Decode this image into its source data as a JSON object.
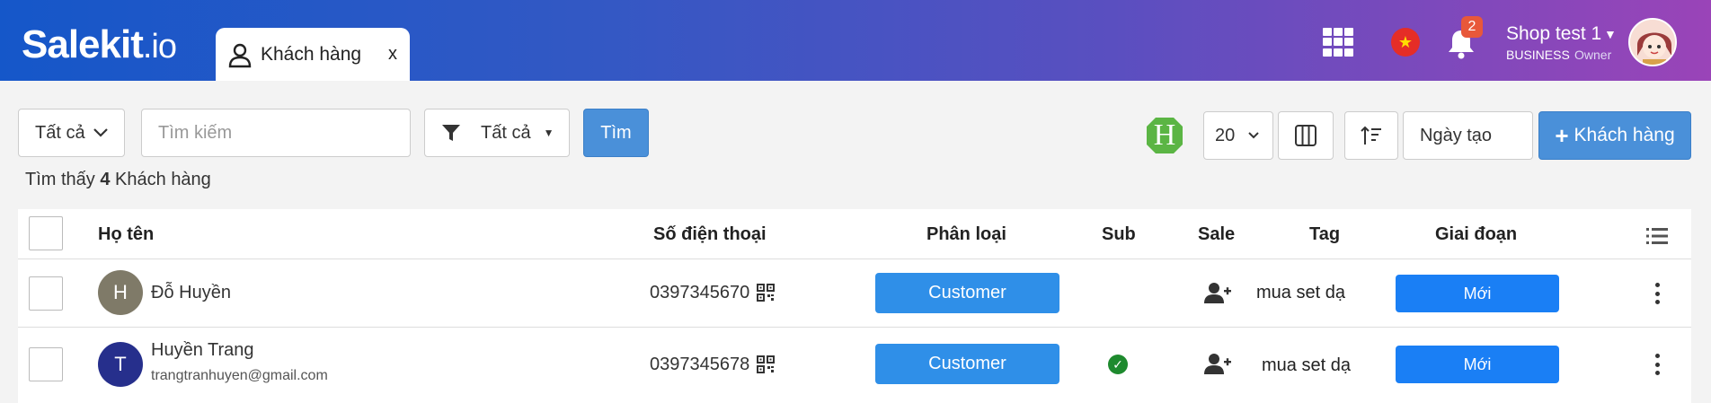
{
  "header": {
    "logo": "Salekit",
    "logo_suffix": ".io",
    "tab": {
      "label": "Khách hàng",
      "close": "x"
    },
    "notifications_count": "2",
    "shop": {
      "name": "Shop test 1",
      "plan": "BUSINESS",
      "role": "Owner"
    },
    "icons": [
      "apps-grid-icon",
      "vietnam-flag-icon",
      "bell-icon",
      "user-avatar"
    ]
  },
  "toolbar": {
    "status_filter": "Tất cả",
    "search_placeholder": "Tìm kiếm",
    "filter_value": "Tất cả",
    "search_button": "Tìm",
    "page_size": "20",
    "sort_field": "Ngày tạo",
    "add_button": "Khách hàng"
  },
  "summary": {
    "prefix": "Tìm thấy",
    "count": "4",
    "suffix": "Khách hàng"
  },
  "table": {
    "columns": {
      "name": "Họ tên",
      "phone": "Số điện thoại",
      "type": "Phân loại",
      "sub": "Sub",
      "sale": "Sale",
      "tag": "Tag",
      "stage": "Giai đoạn"
    },
    "rows": [
      {
        "initial": "H",
        "avatar_color": "#7f7a68",
        "name": "Đỗ Huyền",
        "email": "",
        "phone": "0397345670",
        "type": "Customer",
        "sub": false,
        "tag": "mua set dạ",
        "stage": "Mới"
      },
      {
        "initial": "T",
        "avatar_color": "#262f8c",
        "name": "Huyền Trang",
        "email": "trangtranhuyen@gmail.com",
        "phone": "0397345678",
        "type": "Customer",
        "sub": true,
        "tag": "mua set dạ",
        "stage": "Mới"
      }
    ]
  },
  "colors": {
    "header_gradient_start": "#1557c9",
    "header_gradient_end": "#9a44b8",
    "primary_button": "#4a90d9",
    "type_badge": "#2f8fe8",
    "stage_badge": "#1a7ff5",
    "notification_badge": "#e8583a",
    "sub_check": "#1e8a2e"
  }
}
